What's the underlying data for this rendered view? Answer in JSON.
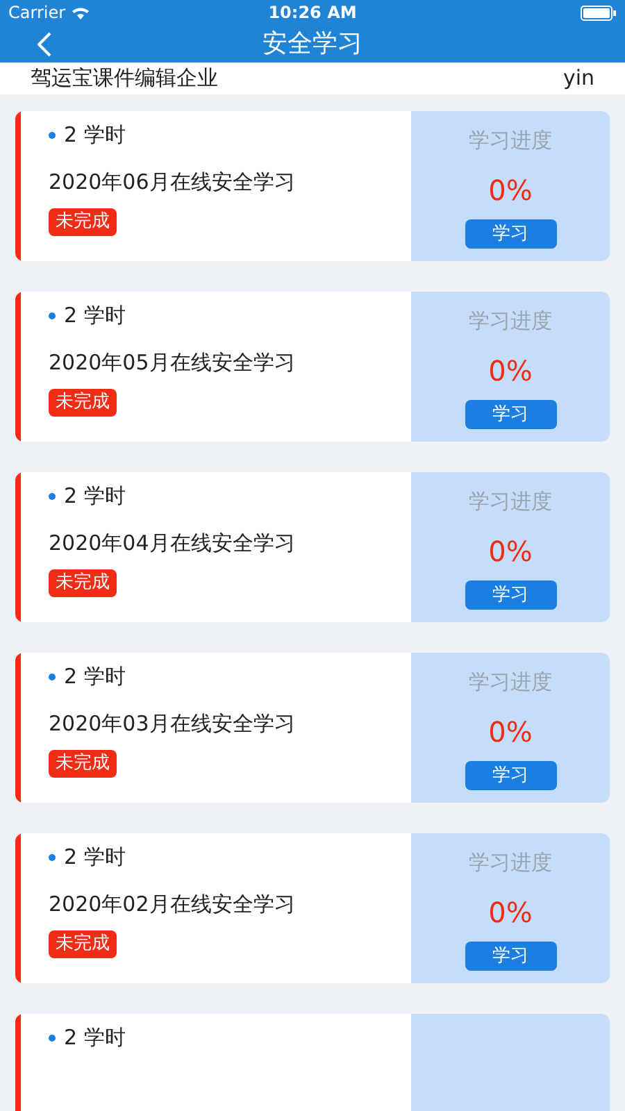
{
  "status_bar": {
    "carrier": "Carrier",
    "time": "10:26 AM"
  },
  "nav": {
    "title": "安全学习"
  },
  "company": {
    "name": "驾运宝课件编辑企业",
    "user": "yin"
  },
  "courses": [
    {
      "hours": "2 学时",
      "title": "2020年06月在线安全学习",
      "status": "未完成",
      "progress_label": "学习进度",
      "progress": "0%",
      "action": "学习"
    },
    {
      "hours": "2 学时",
      "title": "2020年05月在线安全学习",
      "status": "未完成",
      "progress_label": "学习进度",
      "progress": "0%",
      "action": "学习"
    },
    {
      "hours": "2 学时",
      "title": "2020年04月在线安全学习",
      "status": "未完成",
      "progress_label": "学习进度",
      "progress": "0%",
      "action": "学习"
    },
    {
      "hours": "2 学时",
      "title": "2020年03月在线安全学习",
      "status": "未完成",
      "progress_label": "学习进度",
      "progress": "0%",
      "action": "学习"
    },
    {
      "hours": "2 学时",
      "title": "2020年02月在线安全学习",
      "status": "未完成",
      "progress_label": "学习进度",
      "progress": "0%",
      "action": "学习"
    },
    {
      "hours": "2 学时"
    }
  ]
}
